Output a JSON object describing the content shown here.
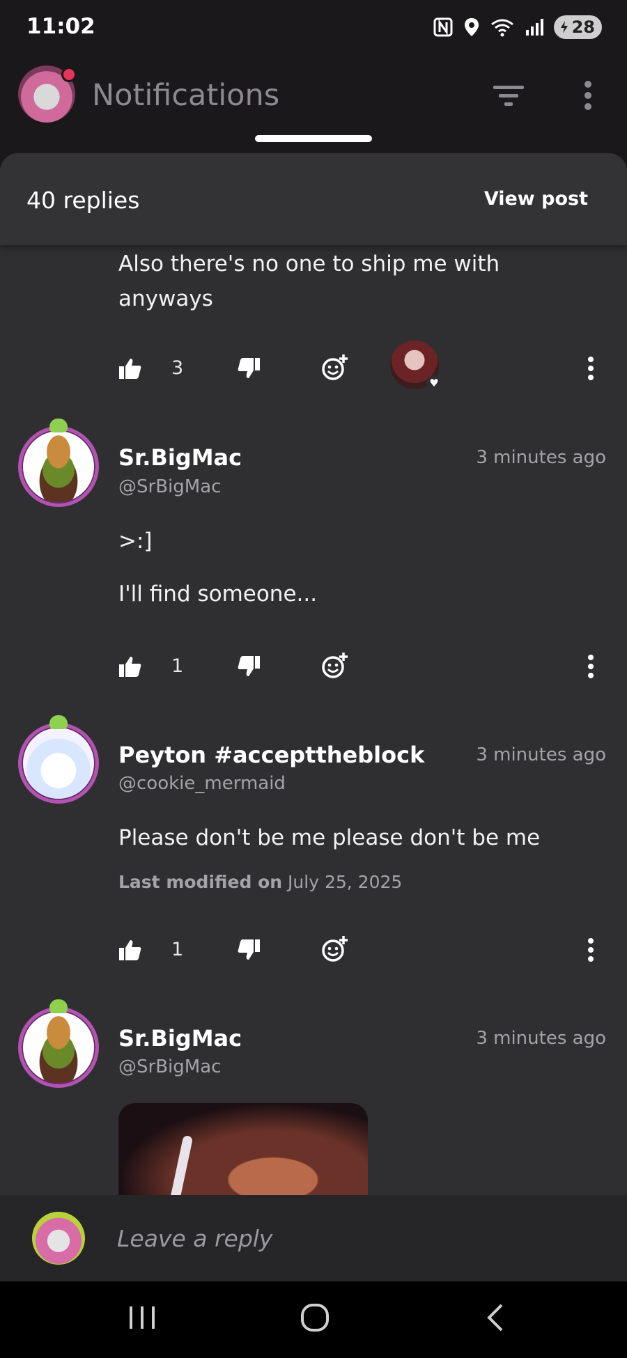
{
  "status_bar": {
    "time": "11:02",
    "battery": "28",
    "icons": [
      "nfc-icon",
      "location-icon",
      "wifi-icon",
      "signal-icon",
      "battery-icon"
    ]
  },
  "header": {
    "title": "Notifications",
    "icons": [
      "filter-icon",
      "more-vert-icon"
    ]
  },
  "sheet": {
    "replies_count": "40 replies",
    "view_post": "View post"
  },
  "comments": [
    {
      "text_lines": [
        "Also there's no one to ship me with",
        "anyways"
      ],
      "likes": "3"
    },
    {
      "name": "Sr.BigMac",
      "handle": "@SrBigMac",
      "time": "3 minutes ago",
      "lines": [
        ">:]",
        "I'll find someone..."
      ],
      "likes": "1"
    },
    {
      "name": "Peyton #accepttheblock",
      "handle": "@cookie_mermaid",
      "time": "3 minutes ago",
      "text": "Please don't be me please don't be me",
      "modified_label": "Last modified on",
      "modified_date": "July 25, 2025",
      "likes": "1"
    },
    {
      "name": "Sr.BigMac",
      "handle": "@SrBigMac",
      "time": "3 minutes ago"
    }
  ],
  "reply": {
    "placeholder": "Leave a reply"
  },
  "colors": {
    "background": "#1b181c",
    "sheet": "#2f2f31",
    "avatar_ring": "#b253b2",
    "muted_text": "#a4a4a8"
  }
}
